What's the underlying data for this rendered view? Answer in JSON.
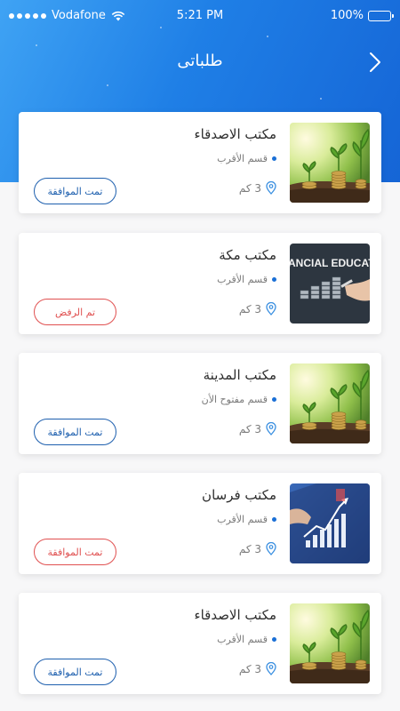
{
  "status_bar": {
    "carrier": "Vodafone",
    "time": "5:21 PM",
    "battery": "100%"
  },
  "header": {
    "title": "طلباتى",
    "back_icon": "chevron-right-icon"
  },
  "colors": {
    "header_gradient_start": "#3fa3f4",
    "header_gradient_end": "#1565d6",
    "approved": "#1d5fae",
    "rejected": "#e05050",
    "bullet": "#1a6fd6"
  },
  "requests": [
    {
      "name": "مكتب الاصدقاء",
      "section": "قسم الأقرب",
      "distance": "3 كم",
      "status": "تمت الموافقة",
      "status_type": "approved",
      "image": "plants-coins"
    },
    {
      "name": "مكتب مكة",
      "section": "قسم الأقرب",
      "distance": "3 كم",
      "status": "تم الرفض",
      "status_type": "rejected",
      "image": "financial-education",
      "image_text": "ANCIAL EDUCAT"
    },
    {
      "name": "مكتب المدينة",
      "section": "قسم مفتوح الأن",
      "distance": "3 كم",
      "status": "تمت الموافقة",
      "status_type": "approved",
      "image": "plants-coins"
    },
    {
      "name": "مكتب فرسان",
      "section": "قسم الأقرب",
      "distance": "3 كم",
      "status": "تمت الموافقة",
      "status_type": "rejected",
      "image": "business-chart"
    },
    {
      "name": "مكتب الاصدقاء",
      "section": "قسم الأقرب",
      "distance": "3 كم",
      "status": "تمت الموافقة",
      "status_type": "approved",
      "image": "plants-coins"
    }
  ]
}
